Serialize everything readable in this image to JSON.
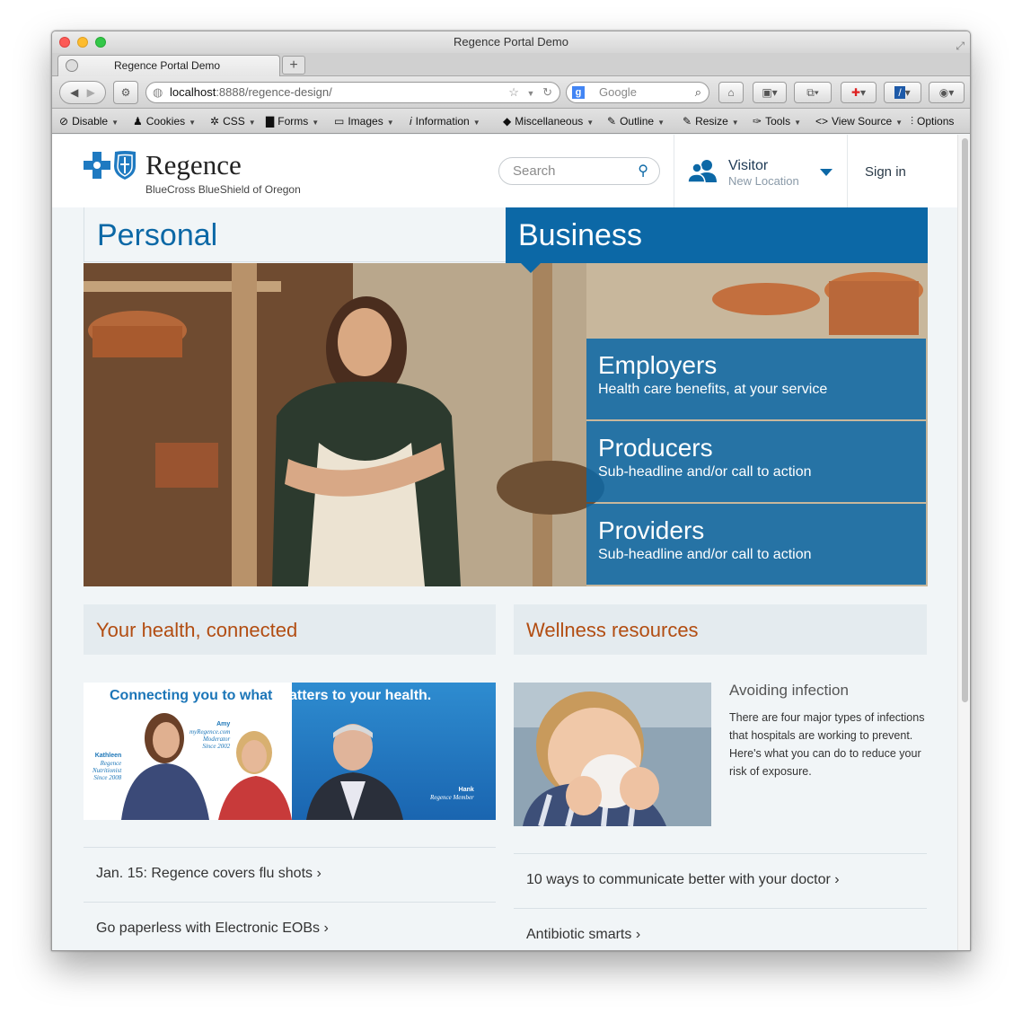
{
  "browser": {
    "window_title": "Regence Portal Demo",
    "tab_title": "Regence Portal Demo",
    "new_tab_label": "+",
    "url_host": "localhost",
    "url_path": ":8888/regence-design/",
    "search_engine": "Google"
  },
  "devbar": {
    "items": [
      {
        "label": "Disable",
        "icon": "ban-icon"
      },
      {
        "label": "Cookies",
        "icon": "person-icon"
      },
      {
        "label": "CSS",
        "icon": "wand-icon"
      },
      {
        "label": "Forms",
        "icon": "form-icon"
      },
      {
        "label": "Images",
        "icon": "image-icon"
      },
      {
        "label": "Information",
        "icon": "info-icon"
      },
      {
        "label": "Miscellaneous",
        "icon": "cube-icon"
      },
      {
        "label": "Outline",
        "icon": "pencil-icon"
      },
      {
        "label": "Resize",
        "icon": "resize-icon"
      },
      {
        "label": "Tools",
        "icon": "wrench-icon"
      },
      {
        "label": "View Source",
        "icon": "code-icon"
      },
      {
        "label": "Options",
        "icon": "sliders-icon"
      }
    ]
  },
  "site": {
    "brand": "Regence",
    "brand_sub": "BlueCross BlueShield of Oregon",
    "search_placeholder": "Search",
    "visitor_name": "Visitor",
    "visitor_location": "New Location",
    "signin": "Sign in",
    "audiences": {
      "personal": "Personal",
      "business": "Business"
    },
    "promos": [
      {
        "title": "Employers",
        "subtitle": "Health care benefits, at your service"
      },
      {
        "title": "Producers",
        "subtitle": "Sub-headline and/or call to action"
      },
      {
        "title": "Providers",
        "subtitle": "Sub-headline and/or call to action"
      }
    ],
    "health": {
      "heading": "Your health, connected",
      "banner_headline_a": "Connecting you to what ",
      "banner_headline_b": "matters to your health.",
      "people": [
        {
          "name": "Kathleen",
          "role": "Regence",
          "role2": "Nutritionist",
          "since": "Since 2008"
        },
        {
          "name": "Amy",
          "role": "myRegence.com",
          "role2": "Moderator",
          "since": "Since 2002"
        },
        {
          "name": "Hank",
          "role": "Regence Member",
          "role2": "",
          "since": ""
        }
      ],
      "links": [
        "Jan. 15: Regence covers flu shots ›",
        "Go paperless with Electronic EOBs ›"
      ]
    },
    "wellness": {
      "heading": "Wellness resources",
      "article_title": "Avoiding infection",
      "article_body": "There are four major types of infections that hospitals are working to prevent. Here's what you can do to reduce your risk of exposure.",
      "links": [
        "10 ways to communicate better with your doctor ›",
        "Antibiotic smarts ›"
      ]
    },
    "colors": {
      "brand_blue": "#0c68a6",
      "heading_orange": "#b24d12",
      "page_bg": "#f1f5f7"
    }
  }
}
